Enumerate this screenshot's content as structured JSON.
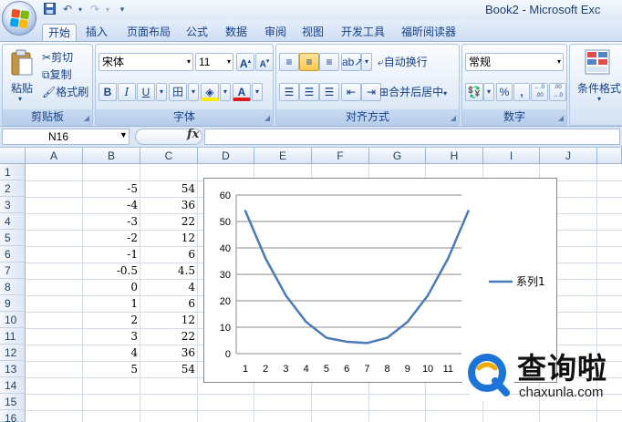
{
  "window": {
    "title": "Book2 - Microsoft Exc"
  },
  "quick_access": [
    "save-icon",
    "undo-icon",
    "redo-icon"
  ],
  "tabs": [
    {
      "label": "开始",
      "active": true
    },
    {
      "label": "插入"
    },
    {
      "label": "页面布局"
    },
    {
      "label": "公式"
    },
    {
      "label": "数据"
    },
    {
      "label": "审阅"
    },
    {
      "label": "视图"
    },
    {
      "label": "开发工具"
    },
    {
      "label": "福昕阅读器"
    }
  ],
  "ribbon": {
    "clipboard": {
      "group_label": "剪贴板",
      "paste": "粘贴",
      "cut": "剪切",
      "copy": "复制",
      "format_painter": "格式刷"
    },
    "font": {
      "group_label": "字体",
      "font_name": "宋体",
      "font_size": "11",
      "bold": "B",
      "italic": "I",
      "underline": "U",
      "phonetic": "wén"
    },
    "alignment": {
      "group_label": "对齐方式",
      "wrap_text": "自动换行",
      "merge_center": "合并后居中"
    },
    "number": {
      "group_label": "数字",
      "format": "常规",
      "percent": "%",
      "comma": ",",
      "increase_decimal": "←.0 .00",
      "decrease_decimal": ".00 →.0"
    },
    "styles": {
      "conditional_format": "条件格式"
    }
  },
  "formula_bar": {
    "name_box": "N16",
    "fx": "fx",
    "formula": ""
  },
  "columns": [
    "A",
    "B",
    "C",
    "D",
    "E",
    "F",
    "G",
    "H",
    "I",
    "J"
  ],
  "rows": [
    "1",
    "2",
    "3",
    "4",
    "5",
    "6",
    "7",
    "8",
    "9",
    "10",
    "11",
    "12",
    "13",
    "14",
    "15",
    "16"
  ],
  "cells": {
    "B": [
      "",
      "-5",
      "-4",
      "-3",
      "-2",
      "-1",
      "-0.5",
      "0",
      "1",
      "2",
      "3",
      "4",
      "5",
      "",
      "",
      ""
    ],
    "C": [
      "",
      "54",
      "36",
      "22",
      "12",
      "6",
      "4.5",
      "4",
      "6",
      "12",
      "22",
      "36",
      "54",
      "",
      "",
      ""
    ]
  },
  "colors": {
    "series": "#4a7ab7",
    "accent": "#1e73d9"
  },
  "chart_data": {
    "type": "line",
    "x": [
      1,
      2,
      3,
      4,
      5,
      6,
      7,
      8,
      9,
      10,
      11,
      12
    ],
    "categories": [
      "1",
      "2",
      "3",
      "4",
      "5",
      "6",
      "7",
      "8",
      "9",
      "10",
      "11",
      "1"
    ],
    "series": [
      {
        "name": "系列1",
        "values": [
          54,
          36,
          22,
          12,
          6,
          4.5,
          4,
          6,
          12,
          22,
          36,
          54
        ]
      }
    ],
    "y_ticks": [
      "0",
      "10",
      "20",
      "30",
      "40",
      "50",
      "60"
    ],
    "ylim": [
      0,
      60
    ],
    "grid": true,
    "legend": "right"
  },
  "watermark": {
    "text": "查询啦",
    "url": "chaxunla.com"
  }
}
